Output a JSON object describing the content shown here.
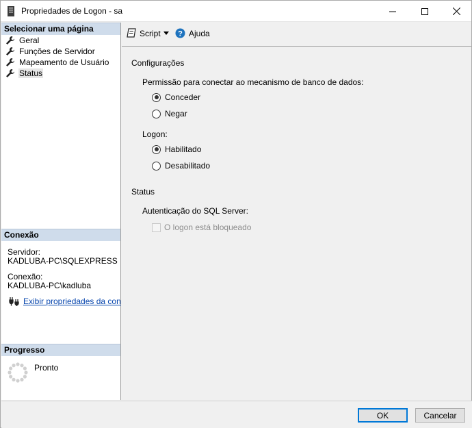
{
  "window": {
    "title": "Propriedades de Logon - sa"
  },
  "left": {
    "select_page_header": "Selecionar uma página",
    "pages": [
      {
        "label": "Geral"
      },
      {
        "label": "Funções de Servidor"
      },
      {
        "label": "Mapeamento de Usuário"
      },
      {
        "label": "Status"
      }
    ],
    "connection_header": "Conexão",
    "server_label": "Servidor:",
    "server_value": "KADLUBA-PC\\SQLEXPRESS",
    "connection_label": "Conexão:",
    "connection_value": "KADLUBA-PC\\kadluba",
    "connection_link": "Exibir propriedades da conexão",
    "progress_header": "Progresso",
    "progress_status": "Pronto"
  },
  "toolbar": {
    "script_label": "Script",
    "help_label": "Ajuda"
  },
  "content": {
    "settings_heading": "Configurações",
    "permission_label": "Permissão para conectar ao mecanismo de banco de dados:",
    "permission_options": [
      {
        "label": "Conceder",
        "checked": true
      },
      {
        "label": "Negar",
        "checked": false
      }
    ],
    "logon_label": "Logon:",
    "logon_options": [
      {
        "label": "Habilitado",
        "checked": true
      },
      {
        "label": "Desabilitado",
        "checked": false
      }
    ],
    "status_heading": "Status",
    "sql_auth_label": "Autenticação do SQL Server:",
    "locked_checkbox_label": "O logon está bloqueado"
  },
  "buttons": {
    "ok_label": "OK",
    "cancel_label": "Cancelar"
  },
  "colors": {
    "section_header_bg": "#cfdceb",
    "link": "#0645ad",
    "help_icon": "#1e73be",
    "default_button_border": "#0078d7"
  }
}
